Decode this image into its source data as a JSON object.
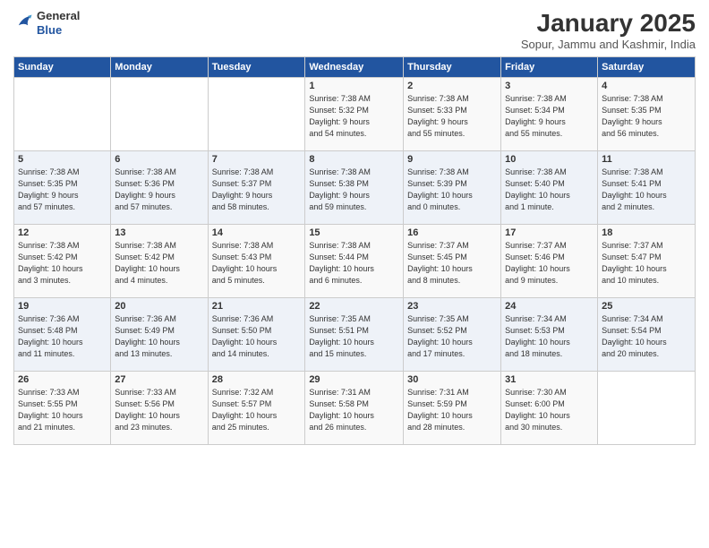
{
  "header": {
    "logo_general": "General",
    "logo_blue": "Blue",
    "title": "January 2025",
    "location": "Sopur, Jammu and Kashmir, India"
  },
  "weekdays": [
    "Sunday",
    "Monday",
    "Tuesday",
    "Wednesday",
    "Thursday",
    "Friday",
    "Saturday"
  ],
  "weeks": [
    [
      {
        "day": "",
        "info": ""
      },
      {
        "day": "",
        "info": ""
      },
      {
        "day": "",
        "info": ""
      },
      {
        "day": "1",
        "info": "Sunrise: 7:38 AM\nSunset: 5:32 PM\nDaylight: 9 hours\nand 54 minutes."
      },
      {
        "day": "2",
        "info": "Sunrise: 7:38 AM\nSunset: 5:33 PM\nDaylight: 9 hours\nand 55 minutes."
      },
      {
        "day": "3",
        "info": "Sunrise: 7:38 AM\nSunset: 5:34 PM\nDaylight: 9 hours\nand 55 minutes."
      },
      {
        "day": "4",
        "info": "Sunrise: 7:38 AM\nSunset: 5:35 PM\nDaylight: 9 hours\nand 56 minutes."
      }
    ],
    [
      {
        "day": "5",
        "info": "Sunrise: 7:38 AM\nSunset: 5:35 PM\nDaylight: 9 hours\nand 57 minutes."
      },
      {
        "day": "6",
        "info": "Sunrise: 7:38 AM\nSunset: 5:36 PM\nDaylight: 9 hours\nand 57 minutes."
      },
      {
        "day": "7",
        "info": "Sunrise: 7:38 AM\nSunset: 5:37 PM\nDaylight: 9 hours\nand 58 minutes."
      },
      {
        "day": "8",
        "info": "Sunrise: 7:38 AM\nSunset: 5:38 PM\nDaylight: 9 hours\nand 59 minutes."
      },
      {
        "day": "9",
        "info": "Sunrise: 7:38 AM\nSunset: 5:39 PM\nDaylight: 10 hours\nand 0 minutes."
      },
      {
        "day": "10",
        "info": "Sunrise: 7:38 AM\nSunset: 5:40 PM\nDaylight: 10 hours\nand 1 minute."
      },
      {
        "day": "11",
        "info": "Sunrise: 7:38 AM\nSunset: 5:41 PM\nDaylight: 10 hours\nand 2 minutes."
      }
    ],
    [
      {
        "day": "12",
        "info": "Sunrise: 7:38 AM\nSunset: 5:42 PM\nDaylight: 10 hours\nand 3 minutes."
      },
      {
        "day": "13",
        "info": "Sunrise: 7:38 AM\nSunset: 5:42 PM\nDaylight: 10 hours\nand 4 minutes."
      },
      {
        "day": "14",
        "info": "Sunrise: 7:38 AM\nSunset: 5:43 PM\nDaylight: 10 hours\nand 5 minutes."
      },
      {
        "day": "15",
        "info": "Sunrise: 7:38 AM\nSunset: 5:44 PM\nDaylight: 10 hours\nand 6 minutes."
      },
      {
        "day": "16",
        "info": "Sunrise: 7:37 AM\nSunset: 5:45 PM\nDaylight: 10 hours\nand 8 minutes."
      },
      {
        "day": "17",
        "info": "Sunrise: 7:37 AM\nSunset: 5:46 PM\nDaylight: 10 hours\nand 9 minutes."
      },
      {
        "day": "18",
        "info": "Sunrise: 7:37 AM\nSunset: 5:47 PM\nDaylight: 10 hours\nand 10 minutes."
      }
    ],
    [
      {
        "day": "19",
        "info": "Sunrise: 7:36 AM\nSunset: 5:48 PM\nDaylight: 10 hours\nand 11 minutes."
      },
      {
        "day": "20",
        "info": "Sunrise: 7:36 AM\nSunset: 5:49 PM\nDaylight: 10 hours\nand 13 minutes."
      },
      {
        "day": "21",
        "info": "Sunrise: 7:36 AM\nSunset: 5:50 PM\nDaylight: 10 hours\nand 14 minutes."
      },
      {
        "day": "22",
        "info": "Sunrise: 7:35 AM\nSunset: 5:51 PM\nDaylight: 10 hours\nand 15 minutes."
      },
      {
        "day": "23",
        "info": "Sunrise: 7:35 AM\nSunset: 5:52 PM\nDaylight: 10 hours\nand 17 minutes."
      },
      {
        "day": "24",
        "info": "Sunrise: 7:34 AM\nSunset: 5:53 PM\nDaylight: 10 hours\nand 18 minutes."
      },
      {
        "day": "25",
        "info": "Sunrise: 7:34 AM\nSunset: 5:54 PM\nDaylight: 10 hours\nand 20 minutes."
      }
    ],
    [
      {
        "day": "26",
        "info": "Sunrise: 7:33 AM\nSunset: 5:55 PM\nDaylight: 10 hours\nand 21 minutes."
      },
      {
        "day": "27",
        "info": "Sunrise: 7:33 AM\nSunset: 5:56 PM\nDaylight: 10 hours\nand 23 minutes."
      },
      {
        "day": "28",
        "info": "Sunrise: 7:32 AM\nSunset: 5:57 PM\nDaylight: 10 hours\nand 25 minutes."
      },
      {
        "day": "29",
        "info": "Sunrise: 7:31 AM\nSunset: 5:58 PM\nDaylight: 10 hours\nand 26 minutes."
      },
      {
        "day": "30",
        "info": "Sunrise: 7:31 AM\nSunset: 5:59 PM\nDaylight: 10 hours\nand 28 minutes."
      },
      {
        "day": "31",
        "info": "Sunrise: 7:30 AM\nSunset: 6:00 PM\nDaylight: 10 hours\nand 30 minutes."
      },
      {
        "day": "",
        "info": ""
      }
    ]
  ]
}
